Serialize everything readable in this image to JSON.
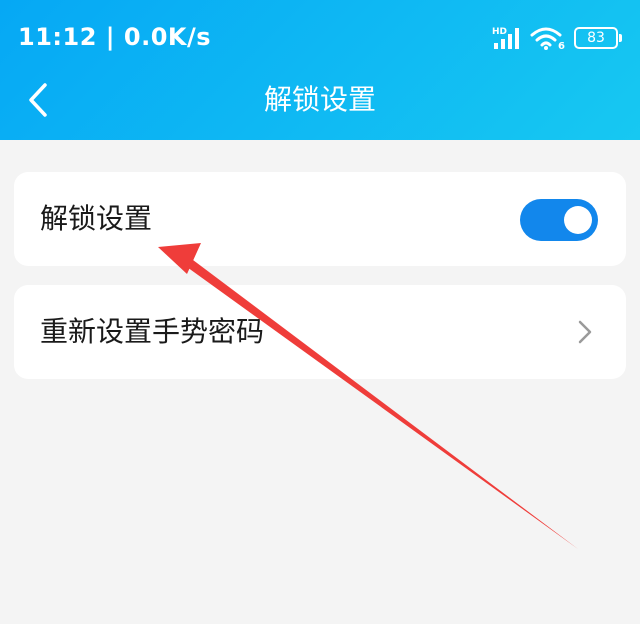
{
  "status_bar": {
    "time_speed": "11:12 | 0.0K/s",
    "network_badge": "HD",
    "wifi_badge": "6",
    "battery_level": "83"
  },
  "nav": {
    "title": "解锁设置"
  },
  "settings": {
    "unlock": {
      "label": "解锁设置",
      "enabled": true
    },
    "reset_gesture": {
      "label": "重新设置手势密码"
    }
  },
  "colors": {
    "header_start": "#06a8f4",
    "header_end": "#17c8f2",
    "toggle_on": "#1287ec",
    "annotation_arrow": "#ef3d3a",
    "background": "#f4f4f4"
  },
  "icons": {
    "back": "chevron-left-icon",
    "row_chevron": "chevron-right-icon",
    "signal": "signal-icon",
    "wifi": "wifi-icon",
    "battery": "battery-icon"
  }
}
